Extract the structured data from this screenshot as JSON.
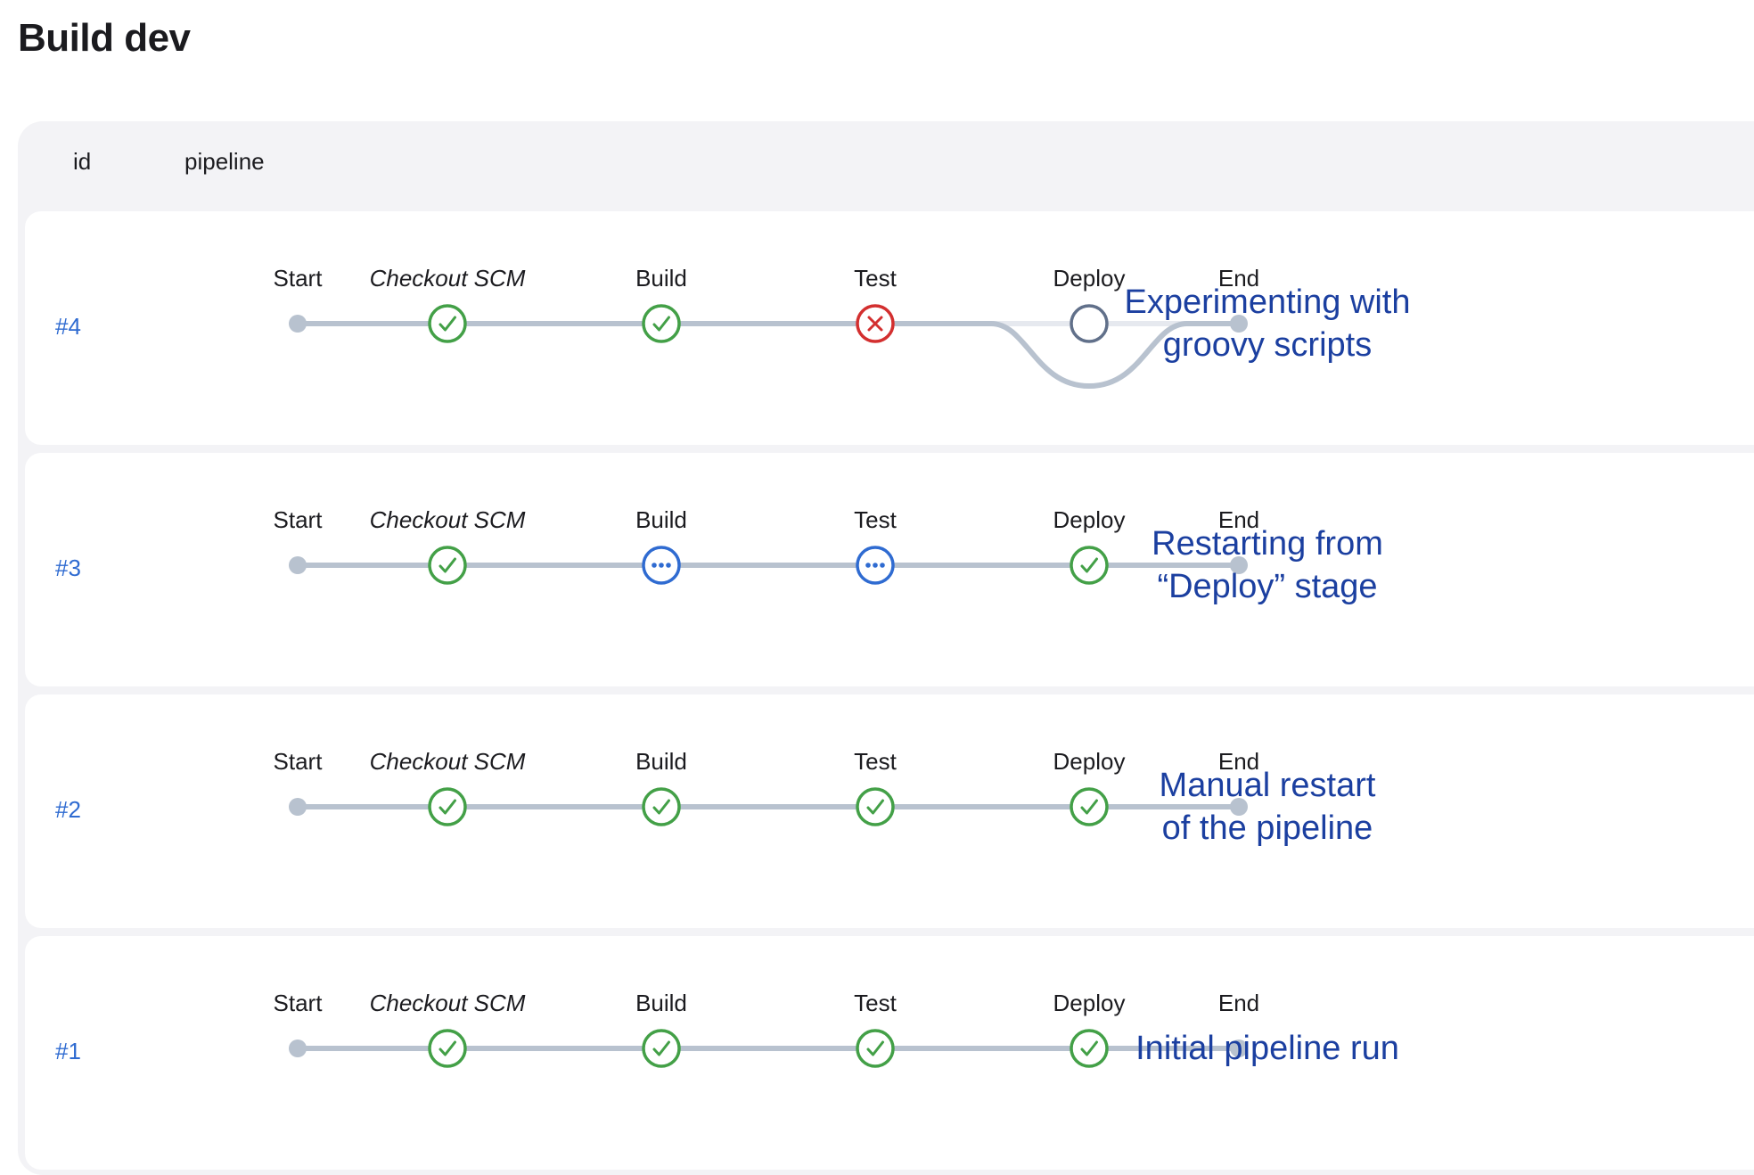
{
  "page": {
    "title": "Build dev"
  },
  "table": {
    "headers": {
      "id": "id",
      "pipeline": "pipeline"
    }
  },
  "stage_names": [
    "Start",
    "Checkout SCM",
    "Build",
    "Test",
    "Deploy",
    "End"
  ],
  "colors": {
    "success": "#43a047",
    "failed": "#d32f2f",
    "in_progress": "#2f6bd1",
    "not_built": "#61708a",
    "connector": "#b8c2cf",
    "annotation": "#1b3fa0",
    "link": "#2f6bd1"
  },
  "runs": [
    {
      "id": "#4",
      "annotation": [
        "Experimenting with",
        "groovy scripts"
      ],
      "statuses": [
        "start",
        "success",
        "success",
        "failed",
        "not_built",
        "end"
      ],
      "deploy_bypassed": true
    },
    {
      "id": "#3",
      "annotation": [
        "Restarting from",
        "“Deploy” stage"
      ],
      "statuses": [
        "start",
        "success",
        "in_progress",
        "in_progress",
        "success",
        "end"
      ],
      "deploy_bypassed": false
    },
    {
      "id": "#2",
      "annotation": [
        "Manual restart",
        "of the pipeline"
      ],
      "statuses": [
        "start",
        "success",
        "success",
        "success",
        "success",
        "end"
      ],
      "deploy_bypassed": false
    },
    {
      "id": "#1",
      "annotation": [
        "Initial pipeline run"
      ],
      "statuses": [
        "start",
        "success",
        "success",
        "success",
        "success",
        "end"
      ],
      "deploy_bypassed": false
    }
  ]
}
